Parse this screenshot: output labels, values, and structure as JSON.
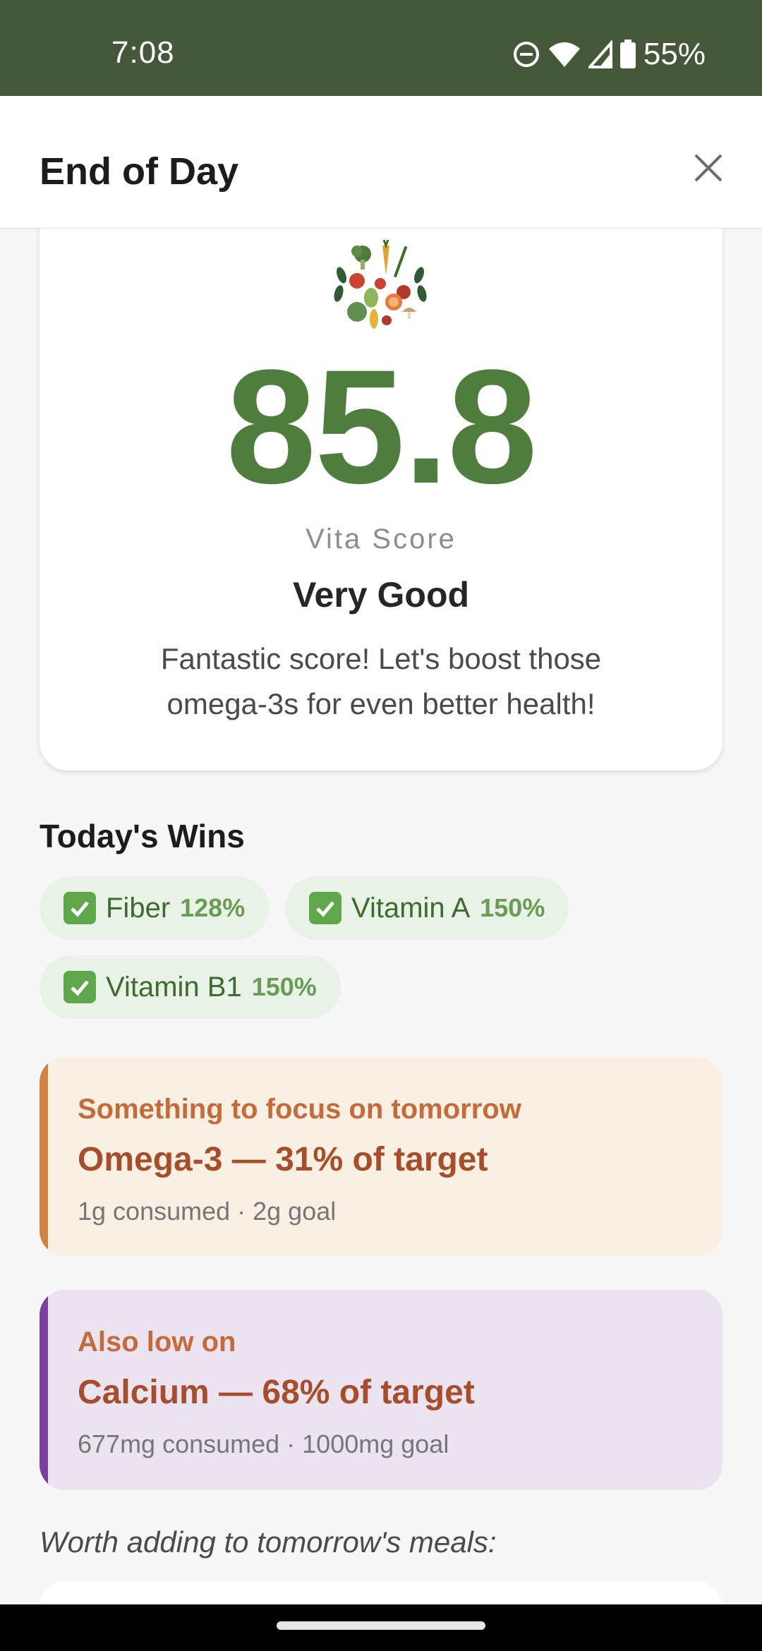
{
  "status_bar": {
    "time": "7:08",
    "battery": "55%"
  },
  "header": {
    "title": "End of Day"
  },
  "score_card": {
    "score": "85.8",
    "label": "Vita Score",
    "rating": "Very Good",
    "message": "Fantastic score! Let's boost those omega-3s for even better health!"
  },
  "wins": {
    "title": "Today's Wins",
    "items": [
      {
        "name": "Fiber",
        "pct": "128%"
      },
      {
        "name": "Vitamin A",
        "pct": "150%"
      },
      {
        "name": "Vitamin B1",
        "pct": "150%"
      }
    ]
  },
  "focus": {
    "label": "Something to focus on tomorrow",
    "headline": "Omega-3 — 31% of target",
    "detail": "1g consumed · 2g goal"
  },
  "also_low": {
    "label": "Also low on",
    "headline": "Calcium — 68% of target",
    "detail": "677mg consumed · 1000mg goal"
  },
  "suggestions": {
    "intro": "Worth adding to tomorrow's meals:"
  },
  "colors": {
    "brand_green": "#4e7d3e",
    "header_green": "#46583a",
    "focus_accent": "#d08241",
    "low_accent": "#7b3fa0"
  },
  "icons": {
    "close": "close-icon",
    "logo": "vegetable-logo-icon",
    "check": "check-icon",
    "dnd": "do-not-disturb-icon",
    "wifi": "wifi-icon",
    "signal": "signal-icon",
    "battery": "battery-icon"
  }
}
